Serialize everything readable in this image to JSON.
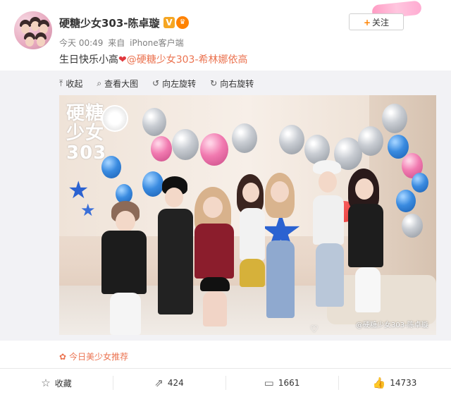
{
  "post": {
    "username": "硬糖少女303-陈卓璇",
    "vip_badge": "V",
    "meta": {
      "time": "今天 00:49",
      "source_prefix": "来自",
      "source": "iPhone客户端"
    },
    "follow_label": "关注",
    "text": {
      "main": "生日快乐小高",
      "mention": "@硬糖少女303-希林娜依高"
    }
  },
  "toolbar": {
    "collapse": "收起",
    "view_large": "查看大图",
    "rotate_left": "向左旋转",
    "rotate_right": "向右旋转"
  },
  "photo": {
    "logo_text": "硬糖少女303",
    "watermark": "@硬糖少女303-陈卓璇"
  },
  "recommend": "今日美少女推荐",
  "actions": {
    "favorite": "收藏",
    "share_count": "424",
    "comment_count": "1661",
    "like_count": "14733"
  },
  "colors": {
    "accent_orange": "#ff8200",
    "link": "#eb7350",
    "heart": "#e0383e"
  }
}
